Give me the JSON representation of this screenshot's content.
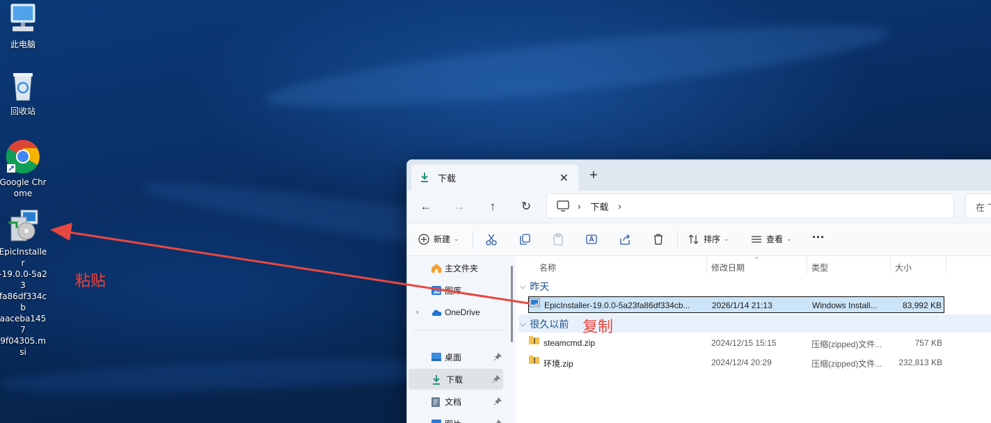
{
  "desktop": {
    "icons": [
      {
        "label": "此电脑",
        "icon": "computer-icon"
      },
      {
        "label": "回收站",
        "icon": "recycle-bin-icon"
      },
      {
        "label": "Google Chrome",
        "icon": "chrome-icon"
      },
      {
        "label": "EpicInstaller-19.0.0-5a23fa86df334cbaaceba14579f04305.msi",
        "label_lines": [
          "EpicInstaller",
          "-19.0.0-5a23",
          "fa86df334cb",
          "aaceba1457",
          "9f04305.msi"
        ],
        "icon": "msi-installer-icon"
      }
    ]
  },
  "annotations": {
    "paste": "粘贴",
    "copy": "复制",
    "arrow_color": "#e8473f"
  },
  "explorer": {
    "tab": {
      "title": "下载"
    },
    "address": {
      "location": "下载",
      "search_placeholder": "在 下"
    },
    "toolbar": {
      "new": "新建",
      "sort": "排序",
      "view": "查看",
      "more": "···"
    },
    "sidebar": {
      "items": [
        "主文件夹",
        "图库",
        "OneDrive",
        "桌面",
        "下载",
        "文档",
        "图片"
      ]
    },
    "columns": {
      "name": "名称",
      "modified": "修改日期",
      "type": "类型",
      "size": "大小"
    },
    "groups": [
      {
        "label": "昨天",
        "files": [
          {
            "name": "EpicInstaller-19.0.0-5a23fa86df334cb...",
            "modified": "2026/1/14 21:13",
            "type": "Windows Install...",
            "size": "83,992 KB",
            "selected": true
          }
        ]
      },
      {
        "label": "很久以前",
        "files": [
          {
            "name": "steamcmd.zip",
            "modified": "2024/12/15 15:15",
            "type": "压缩(zipped)文件...",
            "size": "757 KB"
          },
          {
            "name": "环境.zip",
            "modified": "2024/12/4 20:29",
            "type": "压缩(zipped)文件...",
            "size": "232,813 KB"
          }
        ]
      }
    ]
  }
}
